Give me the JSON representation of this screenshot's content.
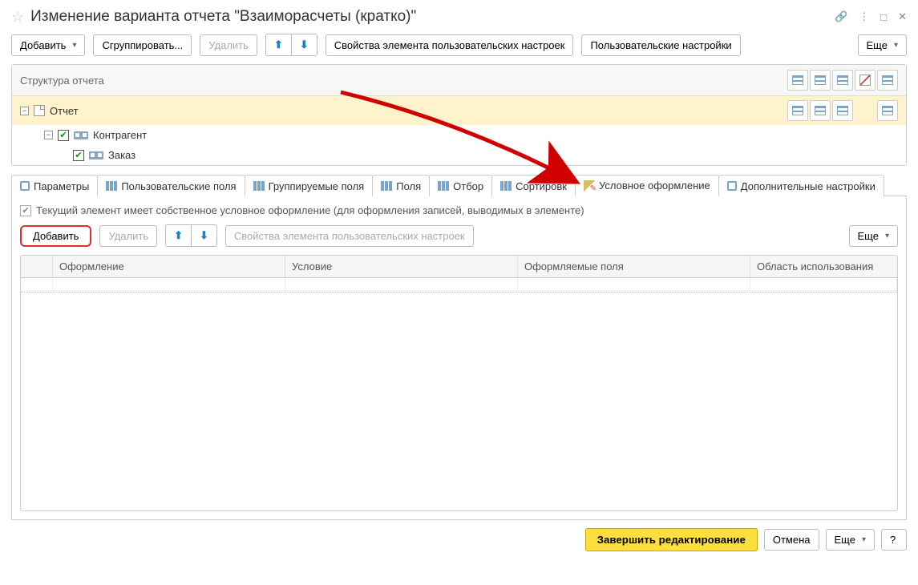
{
  "title": "Изменение варианта отчета \"Взаиморасчеты (кратко)\"",
  "toolbar": {
    "add": "Добавить",
    "group": "Сгруппировать...",
    "delete": "Удалить",
    "props": "Свойства элемента пользовательских настроек",
    "user_settings": "Пользовательские настройки",
    "more": "Еще"
  },
  "panel": {
    "title": "Структура отчета",
    "root": "Отчет",
    "node1": "Контрагент",
    "node2": "Заказ"
  },
  "tabs": {
    "t0": "Параметры",
    "t1": "Пользовательские поля",
    "t2": "Группируемые поля",
    "t3": "Поля",
    "t4": "Отбор",
    "t5": "Сортировк",
    "t6": "Условное оформление",
    "t7": "Дополнительные настройки"
  },
  "cond": {
    "own_label": "Текущий элемент имеет собственное условное оформление (для оформления записей, выводимых в элементе)",
    "add": "Добавить",
    "delete": "Удалить",
    "props": "Свойства элемента пользовательских настроек",
    "more": "Еще",
    "col1": "Оформление",
    "col2": "Условие",
    "col3": "Оформляемые поля",
    "col4": "Область использования"
  },
  "footer": {
    "finish": "Завершить редактирование",
    "cancel": "Отмена",
    "more": "Еще",
    "help": "?"
  }
}
